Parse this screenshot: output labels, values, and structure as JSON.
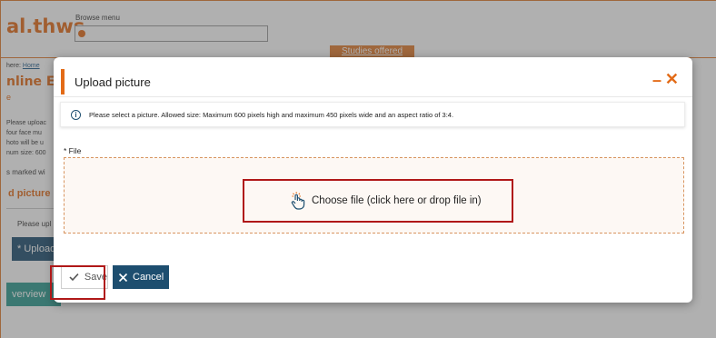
{
  "background": {
    "logo_text": "al.thws",
    "browse_label": "Browse menu",
    "studies_tab": "Studies offered",
    "breadcrumb_prefix": "here:",
    "breadcrumb_home": "Home",
    "page_title": "nline En",
    "page_sub": "e",
    "paragraph_lines": [
      "Please uploac",
      "four face mu",
      "hoto will be u",
      "num size: 600"
    ],
    "marked_text": "s marked wi",
    "upload_heading": "d picture",
    "please_text": "Please upl",
    "upload_button": "* Upload",
    "overview_button": "verview"
  },
  "modal": {
    "title": "Upload picture",
    "minimize_glyph": "–",
    "close_glyph": "✕",
    "info_text": "Please select a picture. Allowed size: Maximum 600 pixels high and maximum 450 pixels wide and an aspect ratio of 3:4.",
    "file_label": "* File",
    "choose_file_text": "Choose file (click here or drop file in)",
    "save_label": "Save",
    "cancel_label": "Cancel"
  },
  "colors": {
    "accent": "#e36b17",
    "primary": "#1d4e6f",
    "highlight": "#b01818"
  }
}
